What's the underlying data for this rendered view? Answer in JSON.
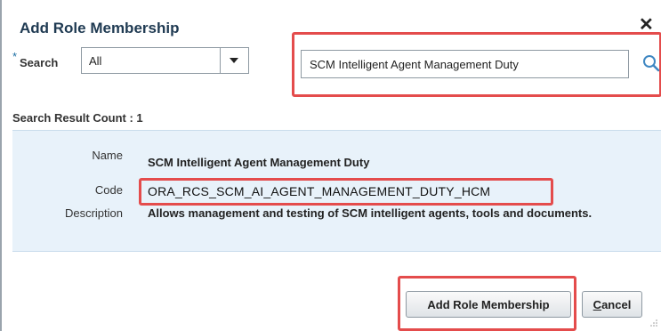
{
  "dialog": {
    "title": "Add Role Membership",
    "close_icon": "close-icon"
  },
  "search": {
    "required_marker": "*",
    "label": "Search",
    "scope_selected": "All",
    "query_value": "SCM Intelligent Agent Management Duty",
    "search_icon": "magnifier-icon"
  },
  "results": {
    "count_text": "Search Result Count : 1",
    "item": {
      "name_label": "Name",
      "name_value": "SCM Intelligent Agent Management Duty",
      "code_label": "Code",
      "code_value": "ORA_RCS_SCM_AI_AGENT_MANAGEMENT_DUTY_HCM",
      "description_label": "Description",
      "description_value": "Allows management and testing of SCM intelligent agents, tools and documents."
    }
  },
  "actions": {
    "add_label": "Add Role Membership",
    "cancel_label_first": "C",
    "cancel_label_rest": "ancel"
  },
  "colors": {
    "highlight": "#e44c4c",
    "result_bg": "#e8f2fa",
    "title": "#1f3a52"
  }
}
